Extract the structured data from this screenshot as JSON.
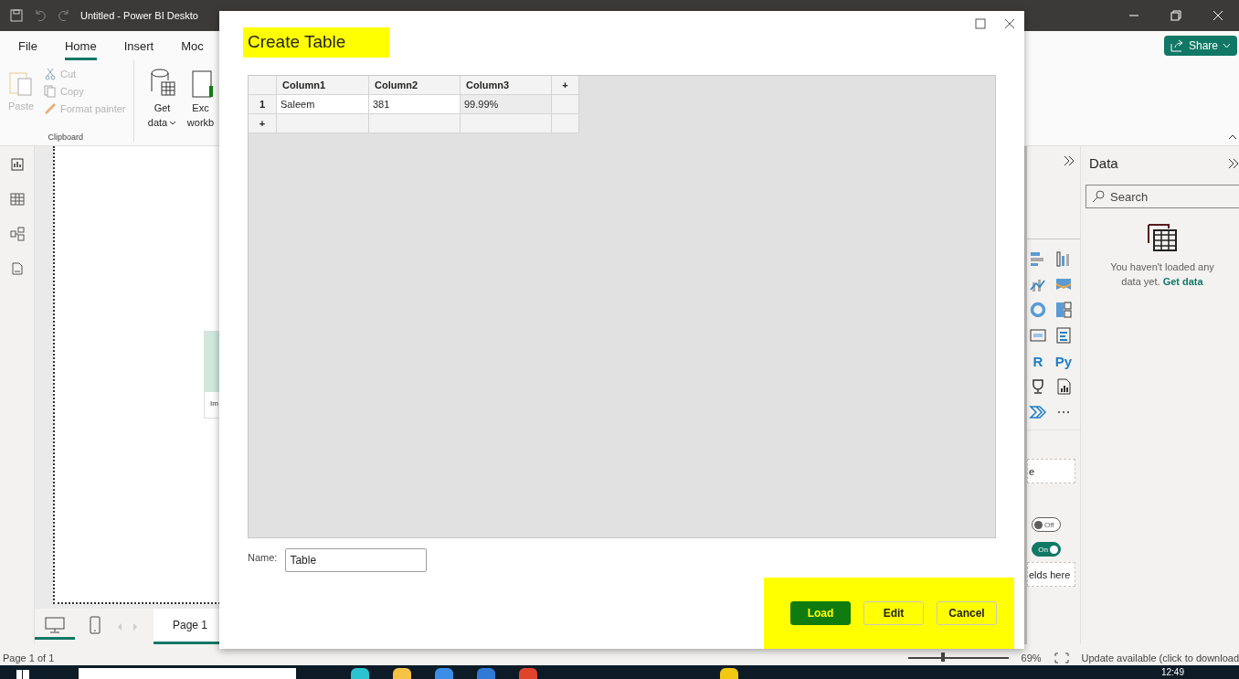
{
  "window": {
    "title": "Untitled - Power BI Deskto"
  },
  "ribbon_tabs": [
    {
      "label": "File",
      "selected": false
    },
    {
      "label": "Home",
      "selected": true
    },
    {
      "label": "Insert",
      "selected": false
    },
    {
      "label": "Moc",
      "selected": false
    }
  ],
  "clipboard": {
    "disabled": true,
    "paste": "Paste",
    "cut": "Cut",
    "copy": "Copy",
    "format_painter": "Format painter",
    "group": "Clipboard"
  },
  "data_group": {
    "get_data": [
      "Get",
      "data"
    ],
    "excel": [
      "Exc",
      "workb"
    ]
  },
  "share": "Share",
  "canvas": {
    "card_text": "Im"
  },
  "view_buttons": [
    {
      "kind": "desktop",
      "selected": true
    },
    {
      "kind": "phone",
      "selected": false
    }
  ],
  "page_tabs": [
    {
      "label": "Page 1",
      "selected": true
    }
  ],
  "visualizations": {
    "labels": [
      "R",
      "Py"
    ],
    "field_wells": [
      "e",
      "elds here"
    ],
    "toggles": [
      {
        "label": "Off",
        "on": false
      },
      {
        "label": "On",
        "on": true
      }
    ]
  },
  "data_pane": {
    "title": "Data",
    "search_placeholder": "Search",
    "empty_text": "You haven't loaded any data yet.",
    "link": "Get data"
  },
  "status_bar": {
    "page": "Page 1 of 1",
    "zoom_slider": {
      "level": 0.35
    },
    "zoom": "69%",
    "update": "Update available (click to download"
  },
  "taskbar": {
    "time": "12:49"
  },
  "dialog": {
    "title": "Create Table",
    "columns": [
      "Column1",
      "Column2",
      "Column3"
    ],
    "add_column": "+",
    "rows": [
      {
        "number": "1",
        "cells": [
          {
            "text": "Saleem",
            "selected": false
          },
          {
            "text": "381",
            "selected": false
          },
          {
            "text": "99.99%",
            "selected": true
          }
        ]
      }
    ],
    "add_row": "+",
    "name_label": "Name:",
    "name_value": "Table",
    "buttons": [
      {
        "label": "Load",
        "primary": true
      },
      {
        "label": "Edit",
        "primary": false
      },
      {
        "label": "Cancel",
        "primary": false
      }
    ]
  }
}
